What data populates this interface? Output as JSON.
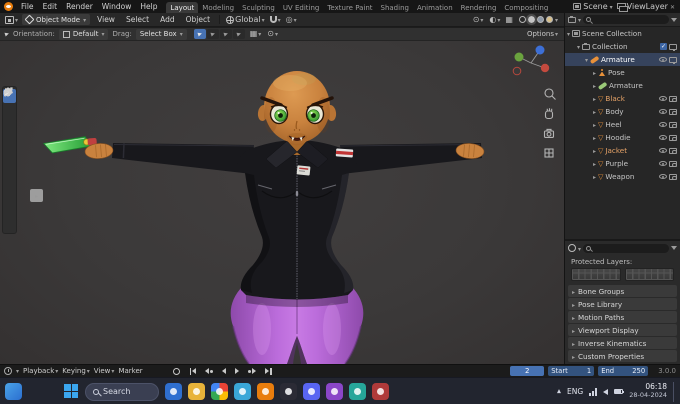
{
  "menubar": {
    "menus": [
      "File",
      "Edit",
      "Render",
      "Window",
      "Help"
    ],
    "workspaces": [
      "Layout",
      "Modeling",
      "Sculpting",
      "UV Editing",
      "Texture Paint",
      "Shading",
      "Animation",
      "Rendering",
      "Compositing"
    ],
    "active_workspace": "Layout",
    "scene_label": "Scene",
    "viewlayer_label": "ViewLayer"
  },
  "viewport_header": {
    "mode": "Object Mode",
    "menus": [
      "View",
      "Select",
      "Add",
      "Object"
    ],
    "orientation": "Global"
  },
  "tool_settings": {
    "orientation_label": "Orientation:",
    "orientation_value": "Default",
    "drag_label": "Drag:",
    "drag_value": "Select Box",
    "options_label": "Options"
  },
  "viewport": {
    "model_colors": {
      "skin": "#c9823e",
      "jacket": "#18181c",
      "pants": "#b766d8",
      "eyes": "#4db344",
      "weapon_blade": "#3ec24d"
    }
  },
  "outliner": {
    "rows": [
      {
        "label": "Scene Collection"
      },
      {
        "label": "Collection"
      },
      {
        "label": "Armature"
      },
      {
        "label": "Pose"
      },
      {
        "label": "Armature"
      },
      {
        "label": "Black"
      },
      {
        "label": "Body"
      },
      {
        "label": "Heel"
      },
      {
        "label": "Hoodie"
      },
      {
        "label": "Jacket"
      },
      {
        "label": "Purple"
      },
      {
        "label": "Weapon"
      }
    ]
  },
  "properties": {
    "protected_layers_label": "Protected Layers:",
    "sections": [
      "Bone Groups",
      "Pose Library",
      "Motion Paths",
      "Viewport Display",
      "Inverse Kinematics",
      "Custom Properties"
    ]
  },
  "timeline": {
    "menus": [
      "Playback",
      "Keying",
      "View",
      "Marker"
    ],
    "current_frame": "2",
    "start_label": "Start",
    "start_value": "1",
    "end_label": "End",
    "end_value": "250"
  },
  "statusbar": {
    "version": "3.0.0"
  },
  "taskbar": {
    "search_label": "Search",
    "language": "ENG",
    "time": "06:18",
    "date": "28-04-2024"
  }
}
